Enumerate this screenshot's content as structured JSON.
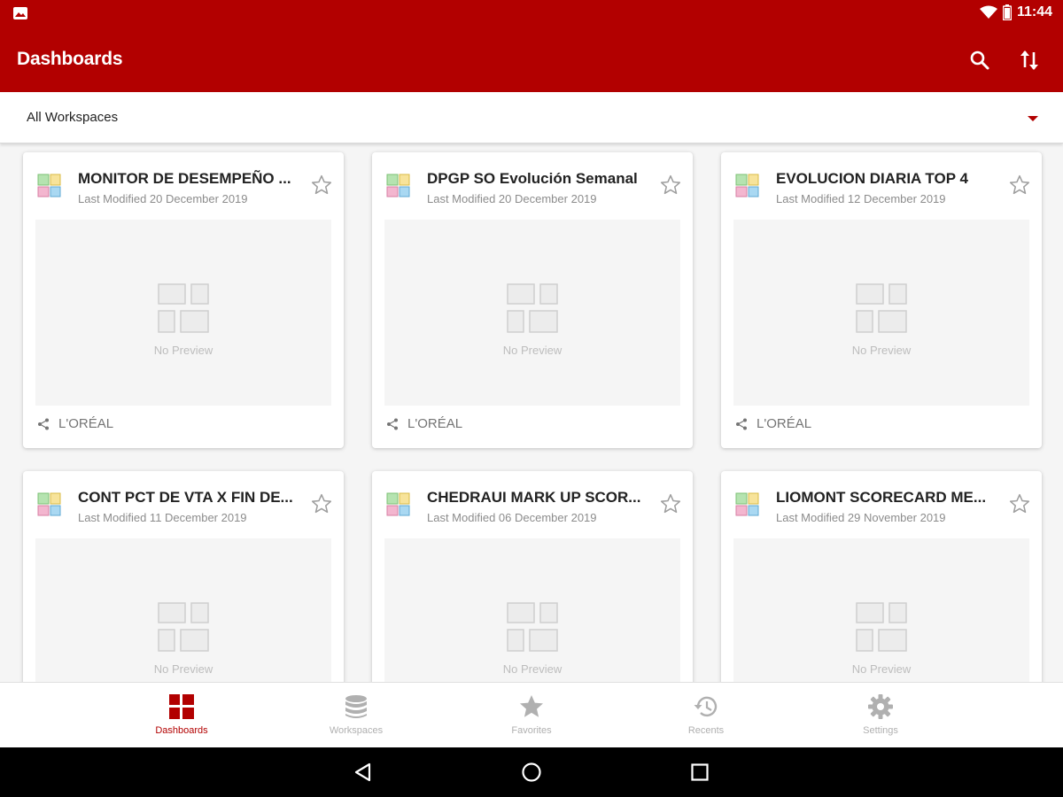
{
  "status_bar": {
    "time": "11:44"
  },
  "app_bar": {
    "title": "Dashboards",
    "search_icon": "search-icon",
    "sort_icon": "sort-icon"
  },
  "workspace_selector": {
    "selected": "All Workspaces"
  },
  "dashboards": [
    {
      "name": "MONITOR DE DESEMPEÑO ...",
      "modified": "Last Modified 20 December 2019",
      "preview_text": "No Preview",
      "owner": "L'ORÉAL"
    },
    {
      "name": "DPGP SO Evolución Semanal",
      "modified": "Last Modified 20 December 2019",
      "preview_text": "No Preview",
      "owner": "L'ORÉAL"
    },
    {
      "name": "EVOLUCION DIARIA TOP 4",
      "modified": "Last Modified 12 December 2019",
      "preview_text": "No Preview",
      "owner": "L'ORÉAL"
    },
    {
      "name": "CONT PCT DE VTA X FIN DE...",
      "modified": "Last Modified 11 December 2019",
      "preview_text": "No Preview"
    },
    {
      "name": "CHEDRAUI MARK UP SCOR...",
      "modified": "Last Modified 06 December 2019",
      "preview_text": "No Preview"
    },
    {
      "name": "LIOMONT SCORECARD ME...",
      "modified": "Last Modified 29 November 2019",
      "preview_text": "No Preview"
    }
  ],
  "bottom_nav": [
    {
      "label": "Dashboards",
      "icon": "dashboard-grid-icon",
      "active": true
    },
    {
      "label": "Workspaces",
      "icon": "database-icon",
      "active": false
    },
    {
      "label": "Favorites",
      "icon": "star-icon",
      "active": false
    },
    {
      "label": "Recents",
      "icon": "history-icon",
      "active": false
    },
    {
      "label": "Settings",
      "icon": "gear-icon",
      "active": false
    }
  ],
  "colors": {
    "brand": "#b20000",
    "inactive": "#b0b0b0"
  }
}
